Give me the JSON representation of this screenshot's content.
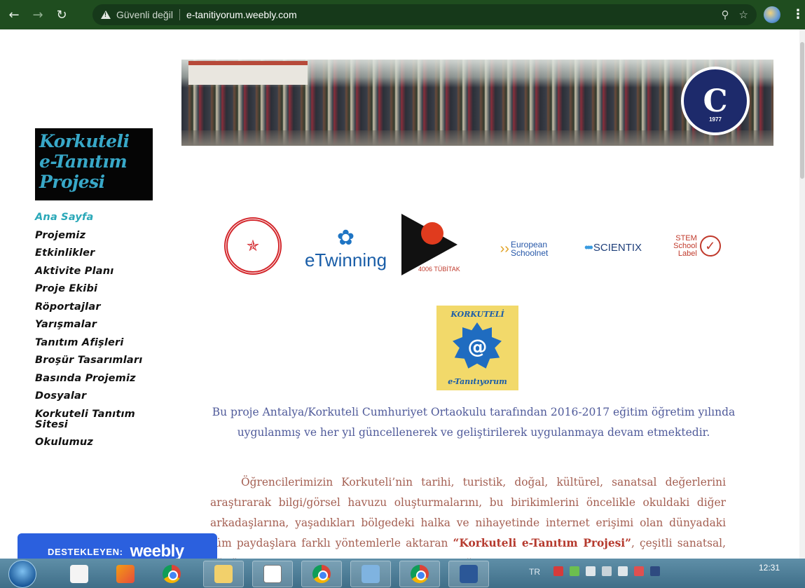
{
  "browser": {
    "security_label": "Güvenli değil",
    "url": "e-tanitiyorum.weebly.com",
    "icons": [
      "back-arrow-icon",
      "forward-arrow-icon",
      "reload-icon",
      "warning-icon",
      "zoom-icon",
      "star-icon",
      "profile-avatar",
      "menu-icon"
    ]
  },
  "site": {
    "logo_lines": [
      "Korkuteli",
      "e-Tanıtım",
      "Projesi"
    ],
    "nav": [
      {
        "label": "Ana Sayfa",
        "active": true
      },
      {
        "label": "Projemiz"
      },
      {
        "label": "Etkinlikler"
      },
      {
        "label": "Aktivite Planı"
      },
      {
        "label": "Proje Ekibi"
      },
      {
        "label": "Röportajlar"
      },
      {
        "label": "Yarışmalar"
      },
      {
        "label": "Tanıtım Afişleri"
      },
      {
        "label": "Broşür Tasarımları"
      },
      {
        "label": "Basında Projemiz"
      },
      {
        "label": "Dosyalar"
      },
      {
        "label": "Korkuteli Tanıtım Sitesi"
      },
      {
        "label": "Okulumuz"
      }
    ]
  },
  "banner": {
    "seal_letter": "C",
    "seal_year": "1977"
  },
  "partners": {
    "etwinning": "eTwinning",
    "tubitak": "4006 TÜBİTAK",
    "eun_line1": "European",
    "eun_line2": "Schoolnet",
    "scientix": "SCIENTIX",
    "stem_line1": "STEM",
    "stem_line2": "School",
    "stem_line3": "Label"
  },
  "project_logo": {
    "top": "KORKUTELİ",
    "at": "@",
    "bottom": "e-Tanıtıyorum"
  },
  "content": {
    "intro": "Bu proje Antalya/Korkuteli Cumhuriyet Ortaokulu tarafından 2016-2017 eğitim öğretim yılında uygulanmış ve her yıl güncellenerek ve geliştirilerek uygulanmaya devam etmektedir.",
    "body_1": "Öğrencilerimizin Korkuteli’nin tarihi, turistik, doğal, kültürel, sanatsal değerlerini araştırarak bilgi/görsel havuzu oluşturmalarını, bu birikimlerini öncelikle okuldaki diğer arkadaşlarına, yaşadıkları bölgedeki halka ve nihayetinde internet erişimi olan dünyadaki tüm paydaşlara farklı yöntemlerle aktaran ",
    "body_bold": "“Korkuteli e-Tanıtım Projesi”",
    "body_2": ", çeşitli sanatsal, kültürel etkinlikler, tasarımlar, videolar ve fotoğraflar ile zenginleştirilmiştir."
  },
  "badge": {
    "label": "DESTEKLEYEN:",
    "brand": "weebly"
  },
  "taskbar": {
    "lang": "TR",
    "clock": "12:31"
  },
  "colors": {
    "chrome": "#1f4d1f",
    "nav_active": "#2aa8b8",
    "intro_text": "#4f5a9a",
    "body_text": "#a45f52",
    "badge": "#2b60de"
  }
}
